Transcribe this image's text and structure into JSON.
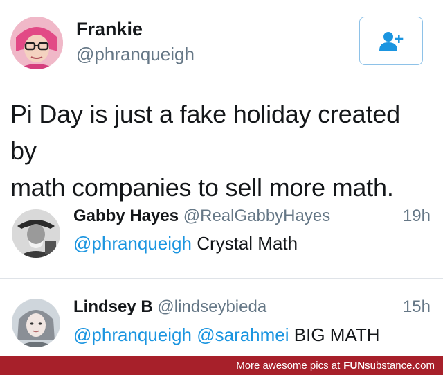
{
  "main_tweet": {
    "author_name": "Frankie",
    "author_handle": "@phranqueigh",
    "text_line1": "Pi Day is just a fake holiday created by",
    "text_line2": "math companies to sell more math.",
    "follow_icon": "add-user-icon"
  },
  "replies": [
    {
      "name": "Gabby Hayes",
      "handle": "@RealGabbyHayes",
      "time": "19h",
      "mention": "@phranqueigh",
      "text": " Crystal Math"
    },
    {
      "name": "Lindsey B",
      "handle": "@lindseybieda",
      "time": "15h",
      "mention": "@phranqueigh @sarahmei",
      "text": " BIG MATH"
    }
  ],
  "footer": {
    "prefix": "More awesome pics at",
    "brand_bold": "FUN",
    "brand_rest": "substance.com"
  },
  "colors": {
    "accent": "#1b95e0",
    "muted": "#657786",
    "footer_bg": "#a7202a"
  }
}
